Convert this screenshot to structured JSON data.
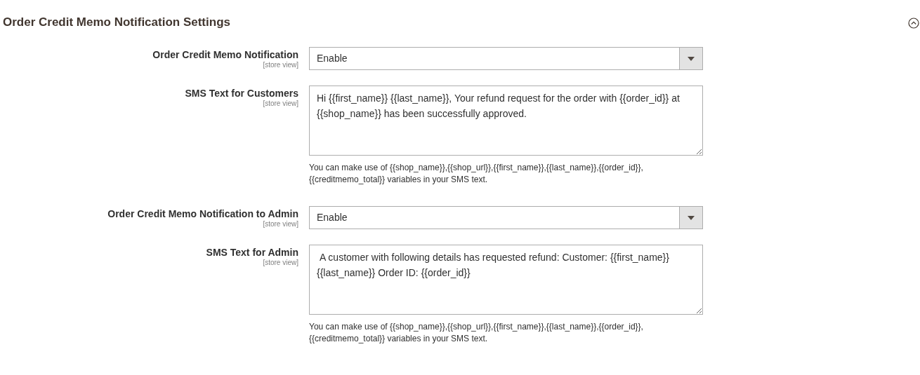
{
  "section": {
    "title": "Order Credit Memo Notification Settings",
    "expanded": true
  },
  "fields": [
    {
      "kind": "select",
      "label": "Order Credit Memo Notification",
      "scope": "[store view]",
      "value": "Enable"
    },
    {
      "kind": "textarea",
      "label": "SMS Text for Customers",
      "scope": "[store view]",
      "value": "Hi {{first_name}} {{last_name}}, Your refund request for the order with {{order_id}} at {{shop_name}} has been successfully approved.",
      "note": "You can make use of {{shop_name}},{{shop_url}},{{first_name}},{{last_name}},{{order_id}}, {{creditmemo_total}} variables in your SMS text."
    },
    {
      "kind": "select",
      "label": "Order Credit Memo Notification to Admin",
      "scope": "[store view]",
      "value": "Enable"
    },
    {
      "kind": "textarea",
      "label": "SMS Text for Admin",
      "scope": "[store view]",
      "value": " A customer with following details has requested refund: Customer: {{first_name}} {{last_name}} Order ID: {{order_id}}",
      "note": "You can make use of {{shop_name}},{{shop_url}},{{first_name}},{{last_name}},{{order_id}}, {{creditmemo_total}} variables in your SMS text."
    }
  ]
}
